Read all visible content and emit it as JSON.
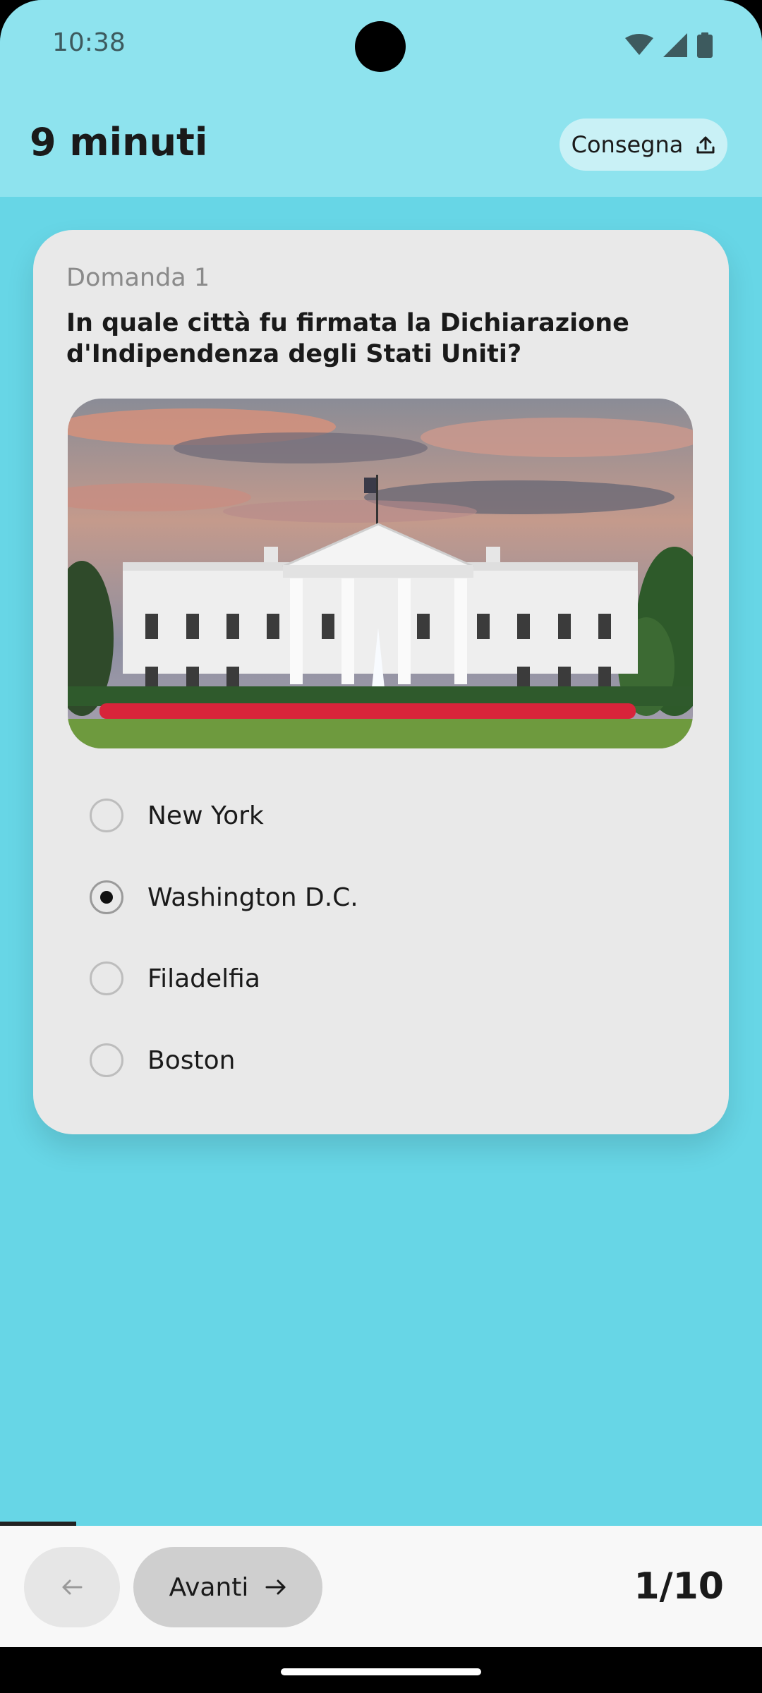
{
  "status_bar": {
    "time": "10:38",
    "icons": [
      "wifi-icon",
      "signal-icon",
      "battery-icon"
    ]
  },
  "app_bar": {
    "title": "9 minuti",
    "submit_label": "Consegna",
    "submit_icon": "upload-icon"
  },
  "question": {
    "number_label": "Domanda 1",
    "text": "In quale città fu firmata la Dichiarazione d'Indipendenza degli Stati Uniti?",
    "image_subject": "white-house-photo",
    "options": [
      {
        "label": "New York",
        "selected": false
      },
      {
        "label": "Washington D.C.",
        "selected": true
      },
      {
        "label": "Filadelfia",
        "selected": false
      },
      {
        "label": "Boston",
        "selected": false
      }
    ]
  },
  "navigation": {
    "prev_icon": "arrow-left-icon",
    "next_label": "Avanti",
    "next_icon": "arrow-right-icon",
    "page_indicator": "1/10",
    "progress_fraction": 0.1
  },
  "colors": {
    "background": "#67d6e6",
    "app_bar": "#8ee3ee",
    "card": "#e9e9e9",
    "submit_button": "#c9f1f6"
  }
}
